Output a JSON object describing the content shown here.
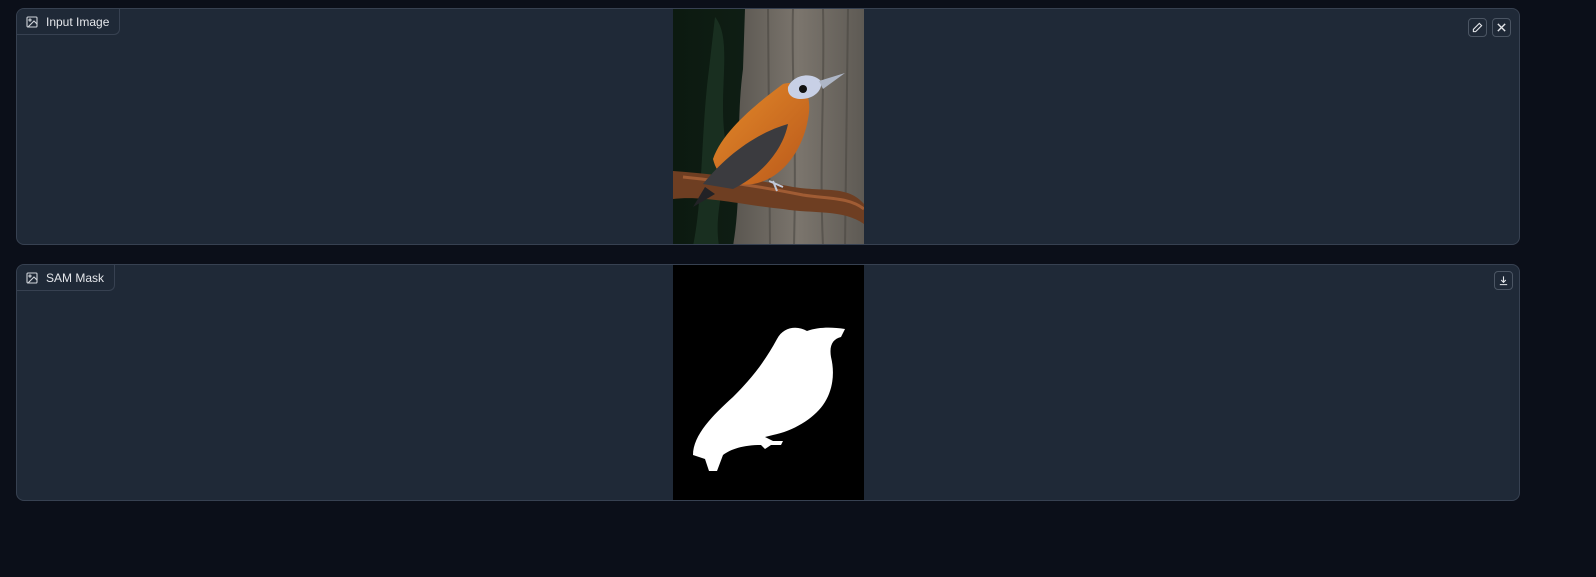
{
  "input_panel": {
    "label": "Input Image",
    "label_icon": "image-icon",
    "image_description": "photo",
    "actions": [
      {
        "name": "edit",
        "icon": "pencil-icon"
      },
      {
        "name": "clear",
        "icon": "close-icon"
      }
    ]
  },
  "mask_panel": {
    "label": "SAM Mask",
    "label_icon": "image-icon",
    "image_description": "mask",
    "actions": [
      {
        "name": "download",
        "icon": "download-icon"
      }
    ]
  },
  "colors": {
    "page_background": "#0b0f19",
    "panel_background": "#1f2937",
    "panel_border": "#374151",
    "bird_orange": "#d9731a",
    "mask_white": "#ffffff",
    "mask_black": "#000000"
  }
}
